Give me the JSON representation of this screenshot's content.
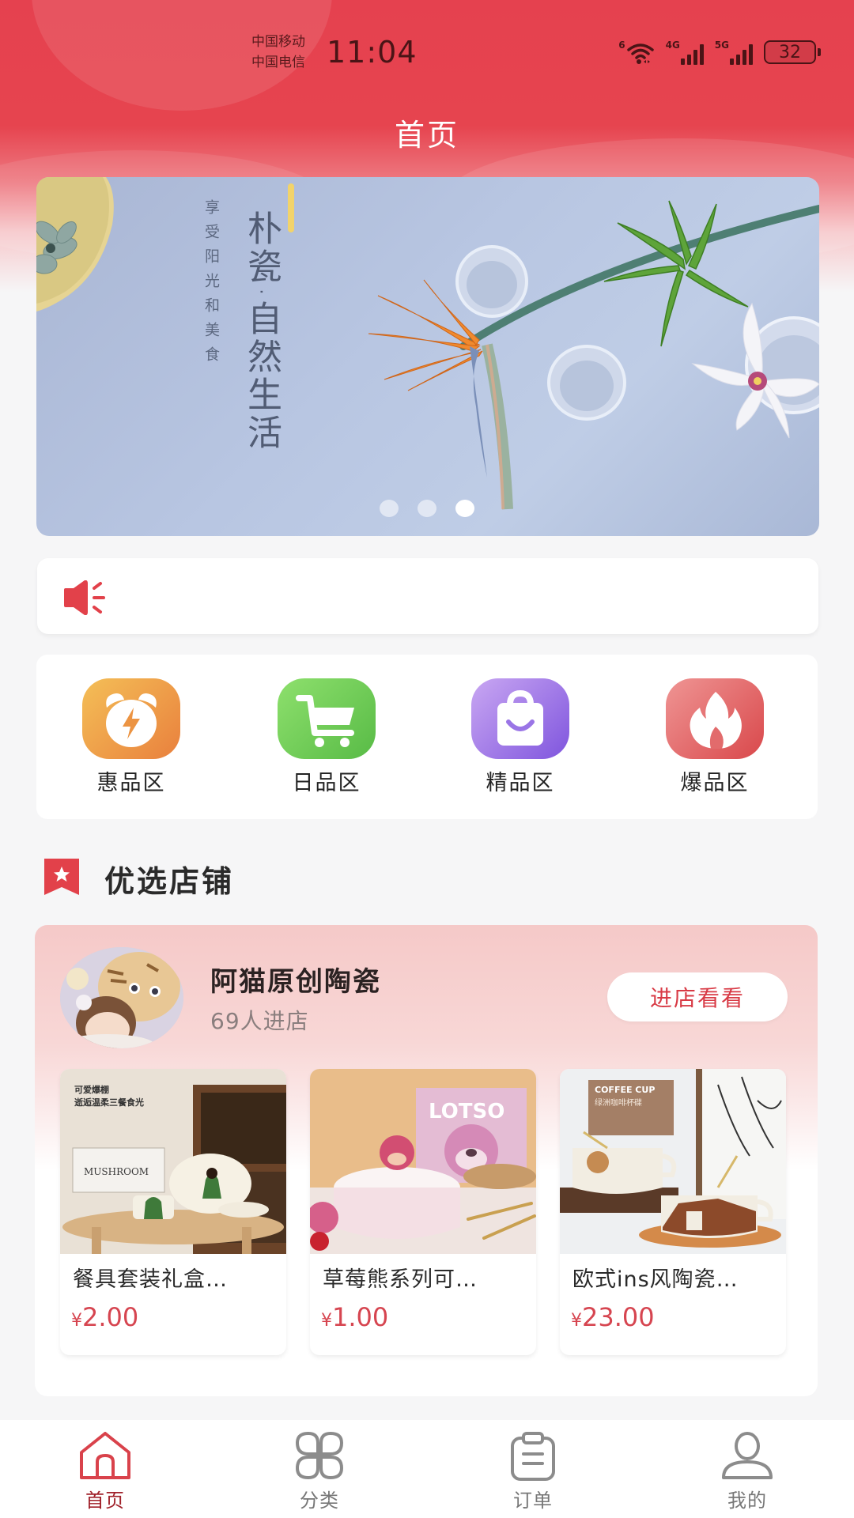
{
  "status_bar": {
    "carrier_1": "中国移动",
    "carrier_2": "中国电信",
    "time": "11:04",
    "wifi_label": "6",
    "signal_1_label": "4G",
    "signal_2_label": "5G",
    "battery": "32"
  },
  "header": {
    "title": "首页"
  },
  "banner": {
    "subtitle": "享受阳光和美食",
    "headline": "朴瓷·自然生活",
    "slide_count": 3,
    "active_slide": 3
  },
  "notice": {
    "icon": "speaker-icon",
    "text": ""
  },
  "categories": [
    {
      "label": "惠品区",
      "icon": "alarm-clock-lightning-icon",
      "color_from": "#f4bf57",
      "color_to": "#e9803d"
    },
    {
      "label": "日品区",
      "icon": "shopping-cart-icon",
      "color_from": "#8ee06d",
      "color_to": "#58bb46"
    },
    {
      "label": "精品区",
      "icon": "shopping-bag-smile-icon",
      "color_from": "#c9a7f2",
      "color_to": "#7f55de"
    },
    {
      "label": "爆品区",
      "icon": "flame-icon",
      "color_from": "#ef9594",
      "color_to": "#d9484b"
    }
  ],
  "section": {
    "title": "优选店铺",
    "icon": "bookmark-star-icon"
  },
  "shop": {
    "name": "阿猫原创陶瓷",
    "visits": "69人进店",
    "enter_button": "进店看看",
    "products": [
      {
        "name": "餐具套装礼盒…",
        "currency": "¥",
        "price": "2.00"
      },
      {
        "name": "草莓熊系列可…",
        "currency": "¥",
        "price": "1.00"
      },
      {
        "name": "欧式ins风陶瓷…",
        "currency": "¥",
        "price": "23.00"
      }
    ]
  },
  "tabbar": {
    "items": [
      {
        "label": "首页",
        "icon": "home-icon",
        "active": true
      },
      {
        "label": "分类",
        "icon": "category-grid-icon",
        "active": false
      },
      {
        "label": "订单",
        "icon": "clipboard-icon",
        "active": false
      },
      {
        "label": "我的",
        "icon": "user-icon",
        "active": false
      }
    ]
  },
  "colors": {
    "brand_red": "#e5414f",
    "price_red": "#d64550",
    "active_tab": "#a0212a",
    "inactive_tab": "#888888"
  }
}
